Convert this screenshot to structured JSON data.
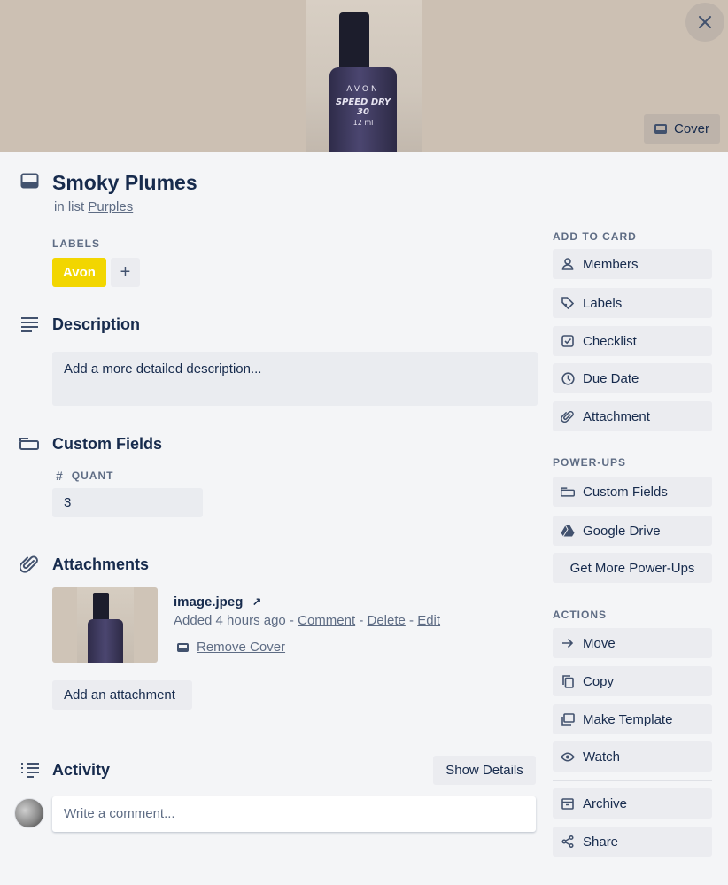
{
  "card": {
    "title": "Smoky Plumes",
    "in_list_prefix": "in list",
    "list_name": "Purples"
  },
  "cover": {
    "button_label": "Cover",
    "photo_brand": "AVON",
    "photo_text_1": "SPEED DRY 30",
    "photo_text_2": "12 ml"
  },
  "labels": {
    "heading": "LABELS",
    "items": [
      {
        "name": "Avon",
        "color": "#f2d600"
      }
    ],
    "add_symbol": "+"
  },
  "description": {
    "heading": "Description",
    "placeholder": "Add a more detailed description..."
  },
  "custom_fields": {
    "heading": "Custom Fields",
    "field_name": "QUANT",
    "field_value": "3"
  },
  "attachments": {
    "heading": "Attachments",
    "file_name": "image.jpeg",
    "external_symbol": "↗",
    "added_text": "Added 4 hours ago -",
    "comment_link": "Comment",
    "sep1": "-",
    "delete_link": "Delete",
    "sep2": "-",
    "edit_link": "Edit",
    "remove_cover": "Remove Cover",
    "add_button": "Add an attachment"
  },
  "activity": {
    "heading": "Activity",
    "show_details": "Show Details",
    "comment_placeholder": "Write a comment..."
  },
  "sidebar": {
    "add_to_card_heading": "ADD TO CARD",
    "add_to_card": [
      {
        "label": "Members",
        "icon": "person-icon"
      },
      {
        "label": "Labels",
        "icon": "tag-icon"
      },
      {
        "label": "Checklist",
        "icon": "checkbox-icon"
      },
      {
        "label": "Due Date",
        "icon": "clock-icon"
      },
      {
        "label": "Attachment",
        "icon": "paperclip-icon"
      }
    ],
    "power_ups_heading": "POWER-UPS",
    "power_ups": [
      {
        "label": "Custom Fields",
        "icon": "field-icon"
      },
      {
        "label": "Google Drive",
        "icon": "drive-icon"
      }
    ],
    "get_more": "Get More Power-Ups",
    "actions_heading": "ACTIONS",
    "actions": [
      {
        "label": "Move",
        "icon": "arrow-right-icon"
      },
      {
        "label": "Copy",
        "icon": "copy-icon"
      },
      {
        "label": "Make Template",
        "icon": "template-icon"
      },
      {
        "label": "Watch",
        "icon": "eye-icon"
      },
      {
        "label": "Archive",
        "icon": "archive-icon"
      },
      {
        "label": "Share",
        "icon": "share-icon"
      }
    ]
  },
  "colors": {
    "cover_bg": "#ccc0b3",
    "label_yellow": "#f2d600",
    "page_bg": "#f4f5f7"
  }
}
